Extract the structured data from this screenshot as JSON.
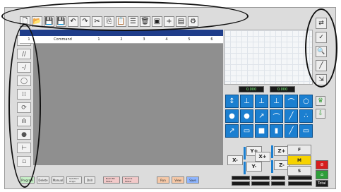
{
  "top_toolbar": {
    "icons": [
      "new-file-icon",
      "open-folder-icon",
      "save-icon",
      "save-as-icon",
      "undo-icon",
      "redo-icon",
      "cut-icon",
      "copy-icon",
      "paste-icon",
      "insert-icon",
      "delete-icon",
      "find-icon",
      "marker-icon",
      "list-icon",
      "settings-icon"
    ],
    "glyphs": [
      "🗋",
      "📂",
      "💾",
      "💾",
      "↶",
      "↷",
      "✂",
      "⎘",
      "📋",
      "☰",
      "🗑",
      "▣",
      "+",
      "▤",
      "⚙"
    ]
  },
  "left_toolbar": {
    "icons": [
      "select-icon",
      "line-icon",
      "dash-icon",
      "circle-icon",
      "grid-icon",
      "rotate-icon",
      "chart-icon",
      "dot-icon",
      "axis-icon",
      "disabled-icon"
    ],
    "glyphs": [
      "▲",
      "//",
      "-/",
      "◯",
      "⁞⁞",
      "⟳",
      "ılı",
      "●",
      "⊢",
      "▫"
    ]
  },
  "table_header": {
    "row_num": "1",
    "col_command": "Command",
    "cols": [
      "1",
      "2",
      "3",
      "4",
      "5",
      "6"
    ]
  },
  "coords": {
    "left": "0.000",
    "right": "0.000"
  },
  "right_toolbar": {
    "icons": [
      "refresh-icon",
      "pin-icon",
      "zoom-icon",
      "measure-icon",
      "cursor-icon"
    ],
    "glyphs": [
      "⇄",
      "✓",
      "🔍",
      "╱",
      "⇲"
    ]
  },
  "blue_icons": {
    "glyphs": [
      "↕",
      "⊥",
      "⊥",
      "⊥",
      "⌒",
      "○",
      "●",
      "●",
      "↗",
      "⌒",
      "╱",
      "∴",
      "↗",
      "▭",
      "■",
      "▮",
      "╱",
      "▭"
    ],
    "names": [
      "vertical-move-icon",
      "base-icon",
      "base-icon",
      "base-icon",
      "arc-icon",
      "circle-icon",
      "point-icon",
      "point-icon",
      "diagonal-icon",
      "curve-icon",
      "line-icon",
      "dots-icon",
      "diagonal-icon",
      "rect-icon",
      "fill-icon",
      "bar-icon",
      "slash-icon",
      "frame-icon"
    ]
  },
  "jog": {
    "xm": "X-",
    "xp": "X+",
    "ym": "Y-",
    "yp": "Y+",
    "zm": "Z-",
    "zp": "Z+",
    "f": "F",
    "m": "M",
    "s": "S"
  },
  "bottom": {
    "buttons": [
      "Program",
      "Delete",
      "Manual",
      "Set Work Origin",
      "Drill",
      "Build 3D Model",
      "Build 2 Model",
      "Run",
      "View",
      "Save"
    ]
  },
  "side": {
    "stop": "⊘",
    "home": "⌂",
    "status": "Total"
  }
}
